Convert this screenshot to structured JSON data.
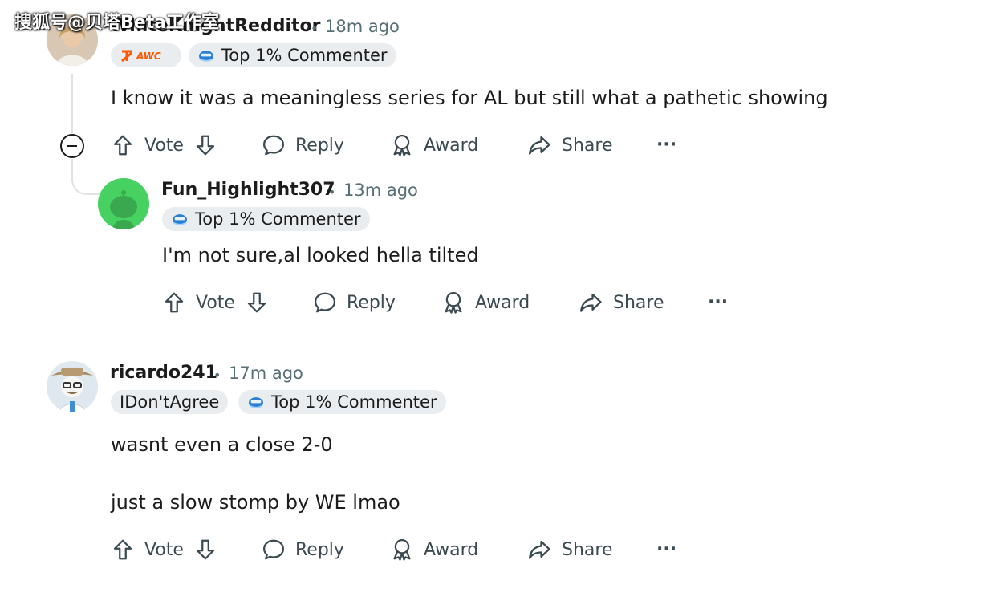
{
  "watermark": "搜狐号@贝塔Beta工作室",
  "comments": [
    {
      "username": "WhiteKnightRedditor",
      "time": "18m ago",
      "flairs": [
        "Top 1% Commenter"
      ],
      "team_flair": "fnatic",
      "body": [
        "I know it was a meaningless series for AL but still what a pathetic showing"
      ],
      "actions": {
        "vote": "Vote",
        "reply": "Reply",
        "award": "Award",
        "share": "Share",
        "more": "···"
      }
    },
    {
      "username": "Fun_Highlight307",
      "time": "13m ago",
      "flairs": [
        "Top 1% Commenter"
      ],
      "body": [
        "I'm not sure,al looked hella tilted"
      ],
      "actions": {
        "vote": "Vote",
        "reply": "Reply",
        "award": "Award",
        "share": "Share",
        "more": "···"
      }
    },
    {
      "username": "ricardo241",
      "time": "17m ago",
      "flairs": [
        "IDon'tAgree",
        "Top 1% Commenter"
      ],
      "body": [
        "wasnt even a close 2-0",
        "just a slow stomp by WE lmao"
      ],
      "actions": {
        "vote": "Vote",
        "reply": "Reply",
        "award": "Award",
        "share": "Share",
        "more": "···"
      }
    }
  ],
  "separator": "•",
  "colors": {
    "text": "#1c1c1c",
    "meta": "#576f76",
    "flair_bg": "#eaedef",
    "thread_line": "#dfe3e6",
    "snoo_green": "#46d160"
  }
}
